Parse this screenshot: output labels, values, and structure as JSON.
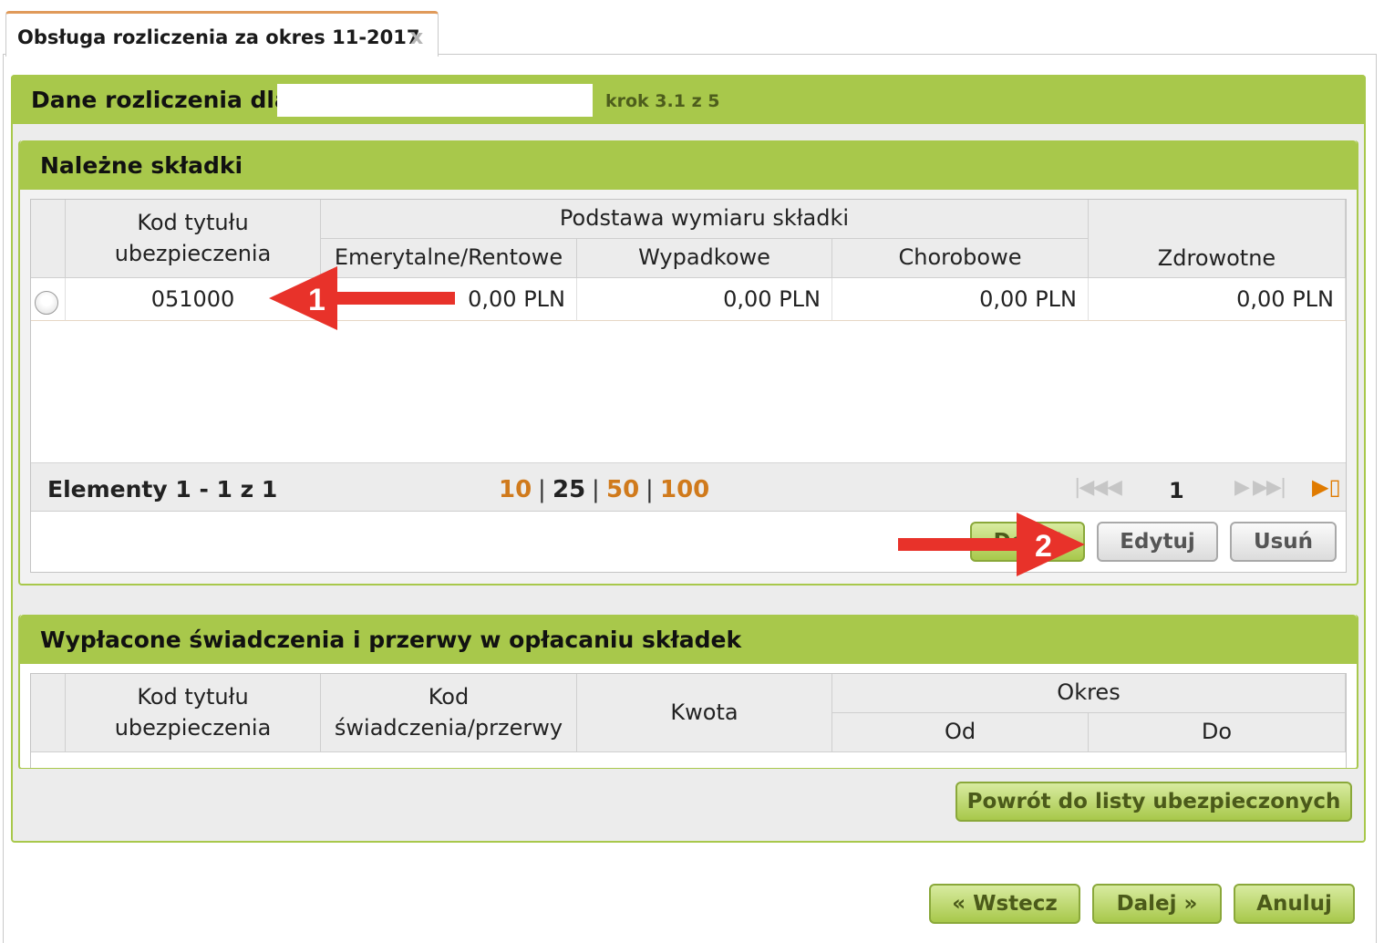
{
  "tab": {
    "title": "Obsługa rozliczenia za okres 11-2017",
    "close": "x"
  },
  "header": {
    "title": "Dane rozliczenia dla",
    "step": "krok 3.1 z 5"
  },
  "contributions": {
    "title": "Należne składki",
    "columns": {
      "code": "Kod tytułu ubezpieczenia",
      "basis_group": "Podstawa wymiaru składki",
      "pension": "Emerytalne/Rentowe",
      "accident": "Wypadkowe",
      "sickness": "Chorobowe",
      "health": "Zdrowotne"
    },
    "rows": [
      {
        "code": "051000",
        "pension": "0,00 PLN",
        "accident": "0,00 PLN",
        "sickness": "0,00 PLN",
        "health": "0,00 PLN"
      }
    ],
    "pager": {
      "info": "Elementy 1 - 1 z 1",
      "sizes": [
        "10",
        "25",
        "50",
        "100"
      ],
      "current_size": "25",
      "separator": "|",
      "page": "1"
    },
    "buttons": {
      "add": "Dodaj",
      "edit": "Edytuj",
      "delete": "Usuń"
    }
  },
  "benefits": {
    "title": "Wypłacone świadczenia i przerwy w opłacaniu składek",
    "columns": {
      "code": "Kod tytułu ubezpieczenia",
      "benefit_code": "Kod świadczenia/przerwy",
      "amount": "Kwota",
      "period": "Okres",
      "from": "Od",
      "to": "Do"
    }
  },
  "back_to_list": "Powrót do listy ubezpieczonych",
  "footer": {
    "back": "« Wstecz",
    "next": "Dalej »",
    "cancel": "Anuluj"
  },
  "annotations": {
    "arrow1": "1",
    "arrow2": "2"
  },
  "colors": {
    "accent_green": "#a8c84b",
    "link_orange": "#d07a1c",
    "annotation_red": "#e8322a"
  }
}
